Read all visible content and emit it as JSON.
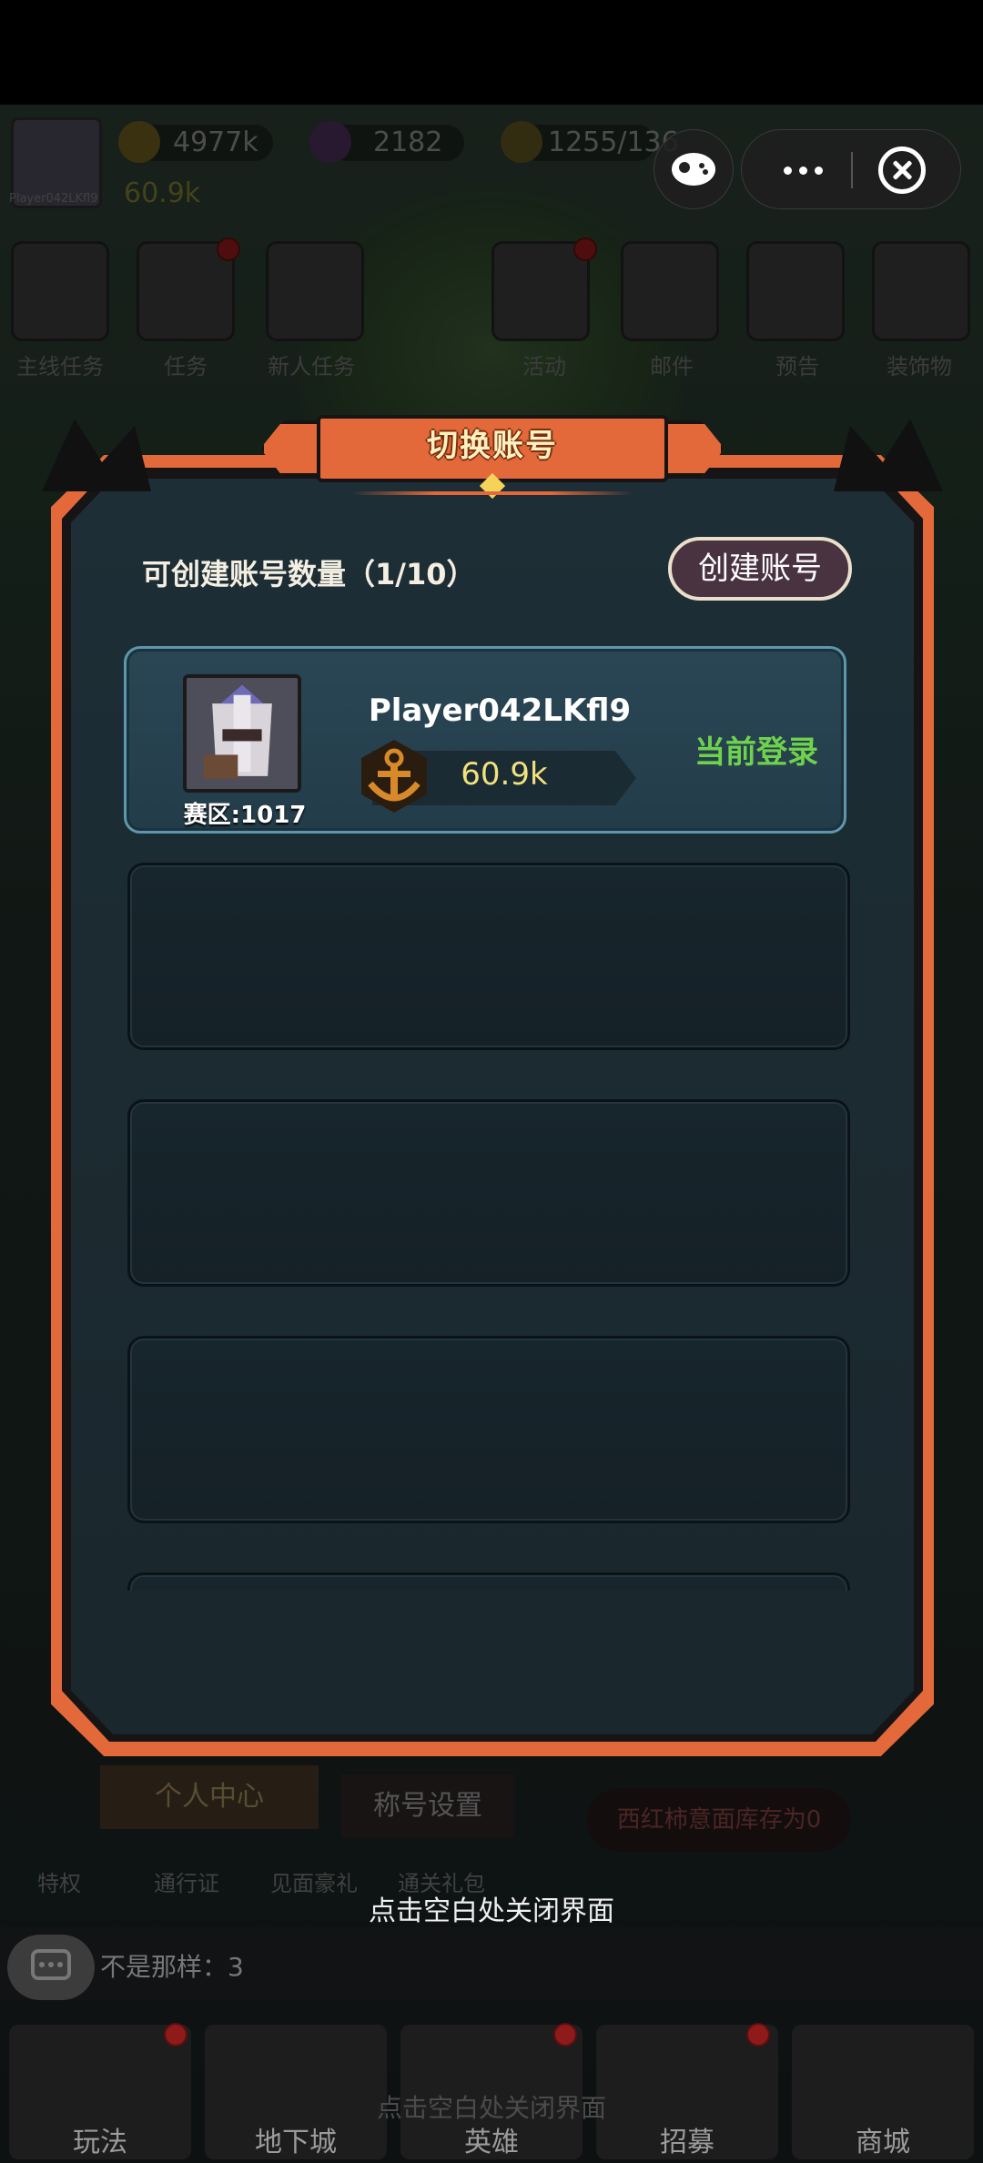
{
  "background": {
    "player_name": "Player042LKfl9",
    "resources": {
      "gold": "4977k",
      "gems": "2182",
      "stamina": "1255/136",
      "power": "60.9k"
    },
    "menu_top": [
      "主线任务",
      "任务",
      "新人任务",
      "活动",
      "邮件",
      "预告",
      "装饰物"
    ],
    "bottom_buttons": {
      "personal_center": "个人中心",
      "title_settings": "称号设置",
      "tomato_notice": "西红柿意面库存为0"
    },
    "bottom_menu": [
      "特权",
      "通行证",
      "见面豪礼",
      "通关礼包"
    ],
    "chat_text": "不是那样：3",
    "nav": [
      "玩法",
      "地下城",
      "英雄",
      "招募",
      "商城"
    ],
    "ghost_hint": "点击空白处关闭界面"
  },
  "dialog": {
    "title": "切换账号",
    "count_label": "可创建账号数量（1/10）",
    "create_button": "创建账号",
    "accounts": [
      {
        "name": "Player042LKfl9",
        "server": "赛区:1017",
        "power": "60.9k",
        "status": "当前登录"
      }
    ],
    "empty_slots": 4
  },
  "close_hint": "点击空白处关闭界面",
  "colors": {
    "frame_orange": "#e4693a",
    "panel_bg": "#1c2a31",
    "active_border": "#5e97ad",
    "status_green": "#6fd24d",
    "power_yellow": "#f2e17d"
  }
}
